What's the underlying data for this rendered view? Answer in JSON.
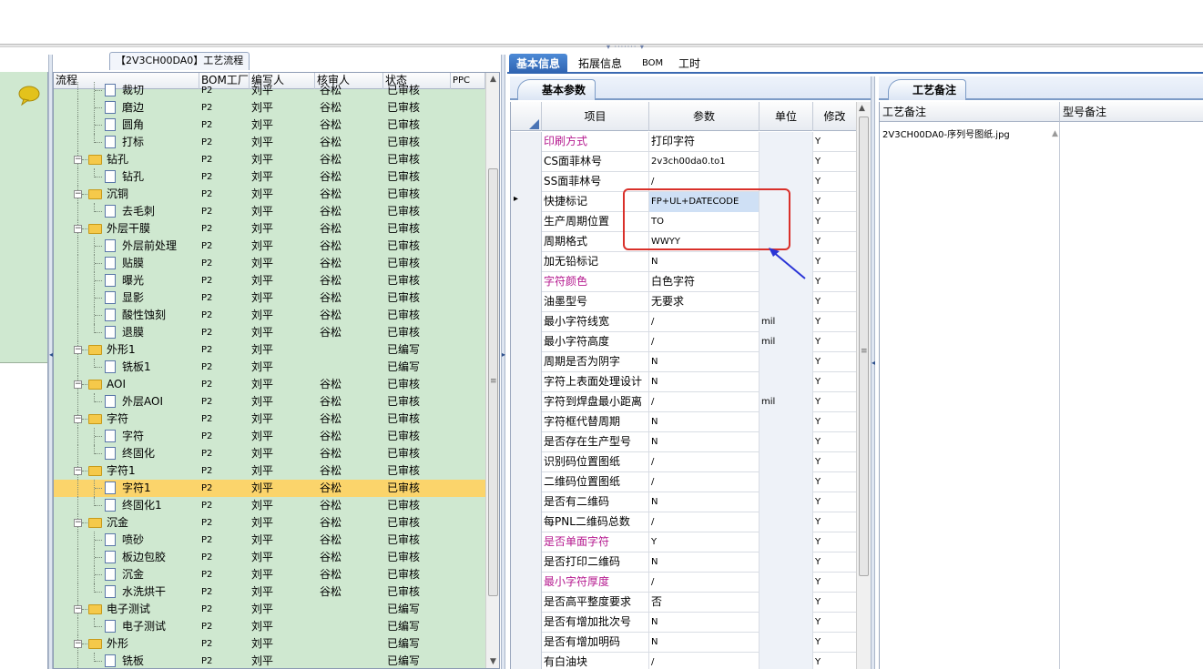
{
  "tree_panel": {
    "title": "【2V3CH00DA0】工艺流程",
    "columns": [
      "流程",
      "BOM工厂",
      "编写人",
      "核审人",
      "状态",
      "PPC"
    ],
    "rows": [
      {
        "name": "裁切",
        "factory": "P2",
        "writer": "刘平",
        "reviewer": "谷松",
        "status": "已审核",
        "type": "doc",
        "level": 2
      },
      {
        "name": "磨边",
        "factory": "P2",
        "writer": "刘平",
        "reviewer": "谷松",
        "status": "已审核",
        "type": "doc",
        "level": 2
      },
      {
        "name": "圆角",
        "factory": "P2",
        "writer": "刘平",
        "reviewer": "谷松",
        "status": "已审核",
        "type": "doc",
        "level": 2
      },
      {
        "name": "打标",
        "factory": "P2",
        "writer": "刘平",
        "reviewer": "谷松",
        "status": "已审核",
        "type": "doc",
        "level": 2
      },
      {
        "name": "钻孔",
        "factory": "P2",
        "writer": "刘平",
        "reviewer": "谷松",
        "status": "已审核",
        "type": "folder",
        "level": 1
      },
      {
        "name": "钻孔",
        "factory": "P2",
        "writer": "刘平",
        "reviewer": "谷松",
        "status": "已审核",
        "type": "doc",
        "level": 2
      },
      {
        "name": "沉铜",
        "factory": "P2",
        "writer": "刘平",
        "reviewer": "谷松",
        "status": "已审核",
        "type": "folder",
        "level": 1
      },
      {
        "name": "去毛刺",
        "factory": "P2",
        "writer": "刘平",
        "reviewer": "谷松",
        "status": "已审核",
        "type": "doc",
        "level": 2
      },
      {
        "name": "外层干膜",
        "factory": "P2",
        "writer": "刘平",
        "reviewer": "谷松",
        "status": "已审核",
        "type": "folder",
        "level": 1
      },
      {
        "name": "外层前处理",
        "factory": "P2",
        "writer": "刘平",
        "reviewer": "谷松",
        "status": "已审核",
        "type": "doc",
        "level": 2
      },
      {
        "name": "贴膜",
        "factory": "P2",
        "writer": "刘平",
        "reviewer": "谷松",
        "status": "已审核",
        "type": "doc",
        "level": 2
      },
      {
        "name": "曝光",
        "factory": "P2",
        "writer": "刘平",
        "reviewer": "谷松",
        "status": "已审核",
        "type": "doc",
        "level": 2
      },
      {
        "name": "显影",
        "factory": "P2",
        "writer": "刘平",
        "reviewer": "谷松",
        "status": "已审核",
        "type": "doc",
        "level": 2
      },
      {
        "name": "酸性蚀刻",
        "factory": "P2",
        "writer": "刘平",
        "reviewer": "谷松",
        "status": "已审核",
        "type": "doc",
        "level": 2
      },
      {
        "name": "退膜",
        "factory": "P2",
        "writer": "刘平",
        "reviewer": "谷松",
        "status": "已审核",
        "type": "doc",
        "level": 2
      },
      {
        "name": "外形1",
        "factory": "P2",
        "writer": "刘平",
        "reviewer": "",
        "status": "已编写",
        "type": "folder",
        "level": 1
      },
      {
        "name": "铣板1",
        "factory": "P2",
        "writer": "刘平",
        "reviewer": "",
        "status": "已编写",
        "type": "doc",
        "level": 2
      },
      {
        "name": "AOI",
        "factory": "P2",
        "writer": "刘平",
        "reviewer": "谷松",
        "status": "已审核",
        "type": "folder",
        "level": 1
      },
      {
        "name": "外层AOI",
        "factory": "P2",
        "writer": "刘平",
        "reviewer": "谷松",
        "status": "已审核",
        "type": "doc",
        "level": 2
      },
      {
        "name": "字符",
        "factory": "P2",
        "writer": "刘平",
        "reviewer": "谷松",
        "status": "已审核",
        "type": "folder",
        "level": 1
      },
      {
        "name": "字符",
        "factory": "P2",
        "writer": "刘平",
        "reviewer": "谷松",
        "status": "已审核",
        "type": "doc",
        "level": 2
      },
      {
        "name": "终固化",
        "factory": "P2",
        "writer": "刘平",
        "reviewer": "谷松",
        "status": "已审核",
        "type": "doc",
        "level": 2
      },
      {
        "name": "字符1",
        "factory": "P2",
        "writer": "刘平",
        "reviewer": "谷松",
        "status": "已审核",
        "type": "folder",
        "level": 1
      },
      {
        "name": "字符1",
        "factory": "P2",
        "writer": "刘平",
        "reviewer": "谷松",
        "status": "已审核",
        "type": "doc",
        "level": 2,
        "selected": true
      },
      {
        "name": "终固化1",
        "factory": "P2",
        "writer": "刘平",
        "reviewer": "谷松",
        "status": "已审核",
        "type": "doc",
        "level": 2
      },
      {
        "name": "沉金",
        "factory": "P2",
        "writer": "刘平",
        "reviewer": "谷松",
        "status": "已审核",
        "type": "folder",
        "level": 1
      },
      {
        "name": "喷砂",
        "factory": "P2",
        "writer": "刘平",
        "reviewer": "谷松",
        "status": "已审核",
        "type": "doc",
        "level": 2
      },
      {
        "name": "板边包胶",
        "factory": "P2",
        "writer": "刘平",
        "reviewer": "谷松",
        "status": "已审核",
        "type": "doc",
        "level": 2
      },
      {
        "name": "沉金",
        "factory": "P2",
        "writer": "刘平",
        "reviewer": "谷松",
        "status": "已审核",
        "type": "doc",
        "level": 2
      },
      {
        "name": "水洗烘干",
        "factory": "P2",
        "writer": "刘平",
        "reviewer": "谷松",
        "status": "已审核",
        "type": "doc",
        "level": 2
      },
      {
        "name": "电子测试",
        "factory": "P2",
        "writer": "刘平",
        "reviewer": "",
        "status": "已编写",
        "type": "folder",
        "level": 1
      },
      {
        "name": "电子测试",
        "factory": "P2",
        "writer": "刘平",
        "reviewer": "",
        "status": "已编写",
        "type": "doc",
        "level": 2
      },
      {
        "name": "外形",
        "factory": "P2",
        "writer": "刘平",
        "reviewer": "",
        "status": "已编写",
        "type": "folder",
        "level": 1
      },
      {
        "name": "铣板",
        "factory": "P2",
        "writer": "刘平",
        "reviewer": "",
        "status": "已编写",
        "type": "doc",
        "level": 2
      }
    ]
  },
  "tabs": [
    "基本信息",
    "拓展信息",
    "BOM",
    "工时"
  ],
  "basic_params": {
    "subtab": "基本参数",
    "columns": [
      "项目",
      "参数",
      "单位",
      "修改"
    ],
    "rows": [
      {
        "item": "印刷方式",
        "value": "打印字符",
        "unit": "",
        "mod": "Y",
        "hl": true
      },
      {
        "item": "CS面菲林号",
        "value": "2v3ch00da0.to1",
        "unit": "",
        "mod": "Y"
      },
      {
        "item": "SS面菲林号",
        "value": "/",
        "unit": "",
        "mod": "Y"
      },
      {
        "item": "快捷标记",
        "value": "FP+UL+DATECODE",
        "unit": "",
        "mod": "Y",
        "current": true
      },
      {
        "item": "生产周期位置",
        "value": "TO",
        "unit": "",
        "mod": "Y"
      },
      {
        "item": "周期格式",
        "value": "WWYY",
        "unit": "",
        "mod": "Y"
      },
      {
        "item": "加无铅标记",
        "value": "N",
        "unit": "",
        "mod": "Y"
      },
      {
        "item": "字符颜色",
        "value": "白色字符",
        "unit": "",
        "mod": "Y",
        "hl": true
      },
      {
        "item": "油墨型号",
        "value": "无要求",
        "unit": "",
        "mod": "Y"
      },
      {
        "item": "最小字符线宽",
        "value": "/",
        "unit": "mil",
        "mod": "Y"
      },
      {
        "item": "最小字符高度",
        "value": "/",
        "unit": "mil",
        "mod": "Y"
      },
      {
        "item": "周期是否为阴字",
        "value": "N",
        "unit": "",
        "mod": "Y"
      },
      {
        "item": "字符上表面处理设计",
        "value": "N",
        "unit": "",
        "mod": "Y"
      },
      {
        "item": "字符到焊盘最小距离",
        "value": "/",
        "unit": "mil",
        "mod": "Y"
      },
      {
        "item": "字符框代替周期",
        "value": "N",
        "unit": "",
        "mod": "Y"
      },
      {
        "item": "是否存在生产型号",
        "value": "N",
        "unit": "",
        "mod": "Y"
      },
      {
        "item": "识别码位置图纸",
        "value": "/",
        "unit": "",
        "mod": "Y"
      },
      {
        "item": "二维码位置图纸",
        "value": "/",
        "unit": "",
        "mod": "Y"
      },
      {
        "item": "是否有二维码",
        "value": "N",
        "unit": "",
        "mod": "Y"
      },
      {
        "item": "每PNL二维码总数",
        "value": "/",
        "unit": "",
        "mod": "Y"
      },
      {
        "item": "是否单面字符",
        "value": "Y",
        "unit": "",
        "mod": "Y",
        "hl": true
      },
      {
        "item": "是否打印二维码",
        "value": "N",
        "unit": "",
        "mod": "Y"
      },
      {
        "item": "最小字符厚度",
        "value": "/",
        "unit": "",
        "mod": "Y",
        "hl": true
      },
      {
        "item": "是否高平整度要求",
        "value": "否",
        "unit": "",
        "mod": "Y"
      },
      {
        "item": "是否有增加批次号",
        "value": "N",
        "unit": "",
        "mod": "Y"
      },
      {
        "item": "是否有增加明码",
        "value": "N",
        "unit": "",
        "mod": "Y"
      },
      {
        "item": "有白油块",
        "value": "/",
        "unit": "",
        "mod": "Y"
      }
    ]
  },
  "notes_panel": {
    "subtab": "工艺备注",
    "col1": "工艺备注",
    "col2": "型号备注",
    "note_text": "2V3CH00DA0-序列号图纸.jpg"
  },
  "colors": {
    "tree_bg": "#cfe8d0",
    "selected_row": "#fbd46b",
    "accent_tab": "#2e62b0",
    "highlight_text": "#b5198f",
    "annotation_red": "#d9302a",
    "annotation_arrow": "#2a35d6"
  }
}
